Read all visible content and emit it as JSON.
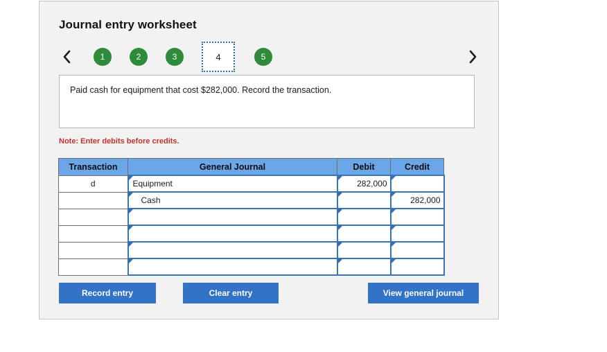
{
  "panel": {
    "title": "Journal entry worksheet"
  },
  "nav": {
    "prev_icon": "chevron-left-icon",
    "next_icon": "chevron-right-icon",
    "tabs": [
      {
        "label": "1",
        "state": "complete"
      },
      {
        "label": "2",
        "state": "complete"
      },
      {
        "label": "3",
        "state": "complete"
      },
      {
        "label": "4",
        "state": "selected"
      },
      {
        "label": "5",
        "state": "complete"
      }
    ],
    "colors": {
      "complete": "#2e8b39",
      "selected_border": "#2b6cb8"
    }
  },
  "prompt": {
    "text": "Paid cash for equipment that cost $282,000. Record the transaction."
  },
  "note": {
    "text": "Note: Enter debits before credits.",
    "color": "#c0322b"
  },
  "table": {
    "headers": {
      "transaction": "Transaction",
      "general_journal": "General Journal",
      "debit": "Debit",
      "credit": "Credit"
    },
    "header_bg": "#6ba7e8",
    "rows": [
      {
        "transaction": "d",
        "general_journal": "Equipment",
        "debit": "282,000",
        "credit": "",
        "indent": false
      },
      {
        "transaction": "",
        "general_journal": "Cash",
        "debit": "",
        "credit": "282,000",
        "indent": true
      },
      {
        "transaction": "",
        "general_journal": "",
        "debit": "",
        "credit": "",
        "indent": false
      },
      {
        "transaction": "",
        "general_journal": "",
        "debit": "",
        "credit": "",
        "indent": false
      },
      {
        "transaction": "",
        "general_journal": "",
        "debit": "",
        "credit": "",
        "indent": false
      },
      {
        "transaction": "",
        "general_journal": "",
        "debit": "",
        "credit": "",
        "indent": false
      }
    ]
  },
  "buttons": {
    "record": "Record entry",
    "clear": "Clear entry",
    "view": "View general journal",
    "color": "#3273c8"
  }
}
